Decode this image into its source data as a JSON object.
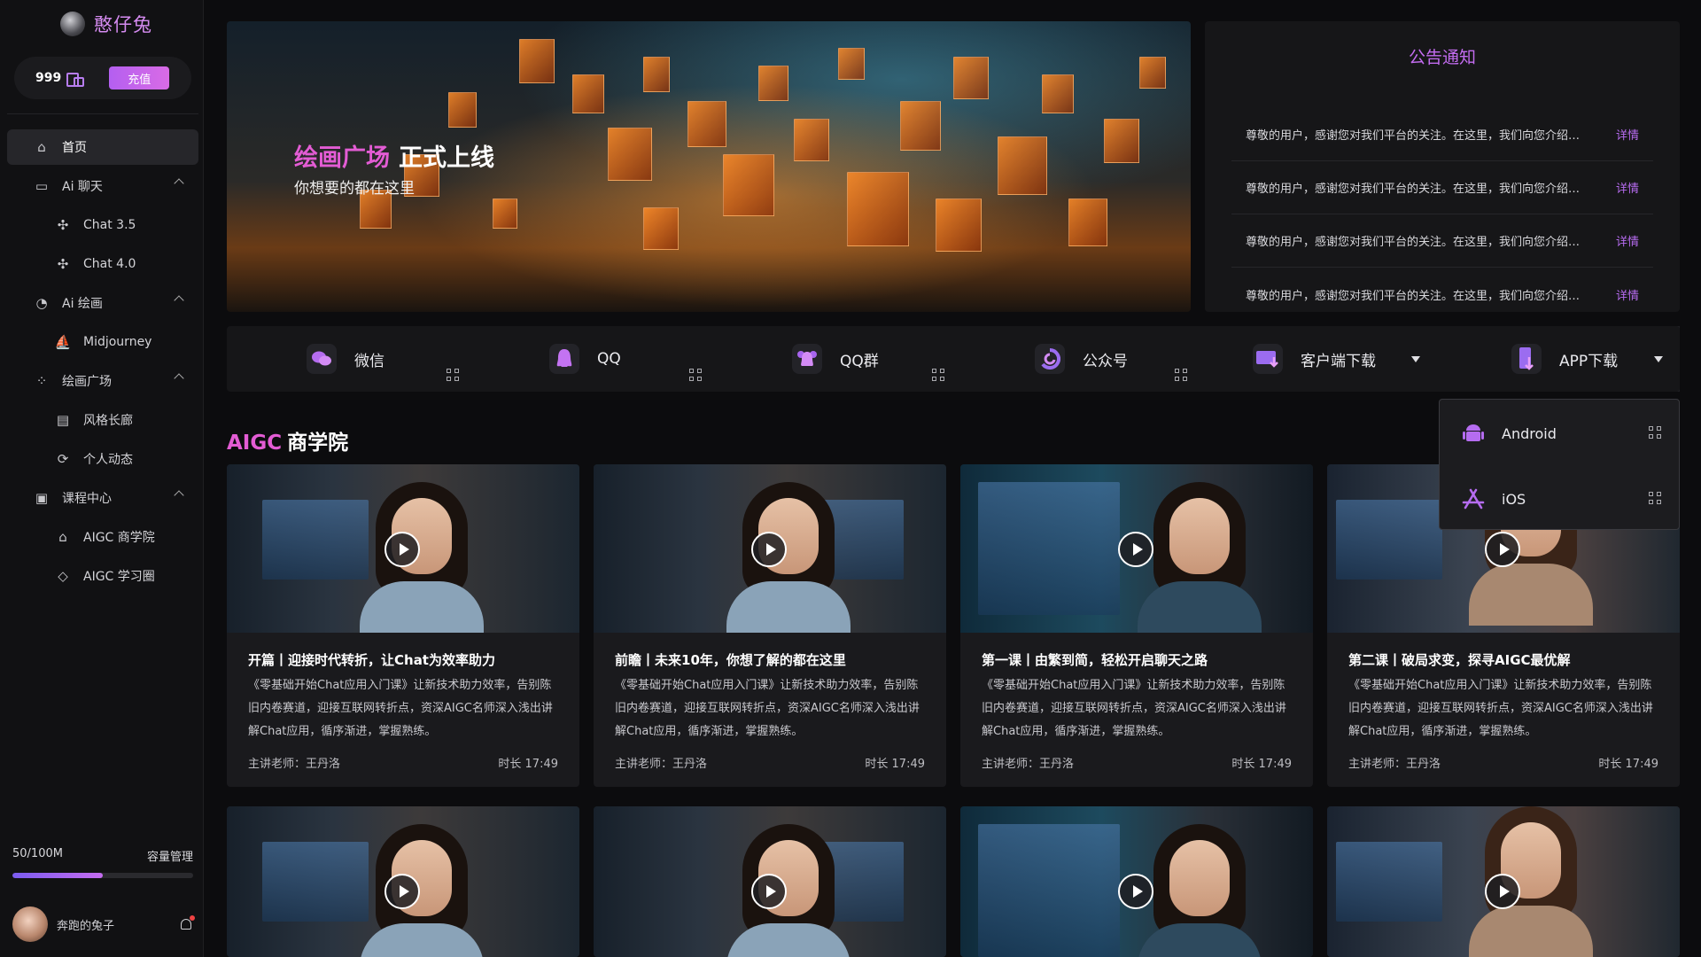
{
  "brand": {
    "name": "憨仔兔"
  },
  "balance": {
    "amount": "999",
    "recharge_label": "充值"
  },
  "nav": {
    "home": "首页",
    "ai_chat": "Ai 聊天",
    "chat35": "Chat 3.5",
    "chat40": "Chat 4.0",
    "ai_paint": "Ai 绘画",
    "midjourney": "Midjourney",
    "plaza": "绘画广场",
    "gallery": "风格长廊",
    "feed": "个人动态",
    "courses": "课程中心",
    "aigc_school": "AIGC 商学院",
    "aigc_circle": "AIGC 学习圈"
  },
  "storage": {
    "usage": "50/100M",
    "manage_label": "容量管理",
    "fraction": 0.5
  },
  "user": {
    "name": "奔跑的兔子"
  },
  "banner": {
    "title_highlight": "绘画广场",
    "title_rest": "正式上线",
    "subtitle": "你想要的都在这里"
  },
  "notice": {
    "title": "公告通知",
    "items": [
      {
        "text": "尊敬的用户，感谢您对我们平台的关注。在这里，我们向您介绍平台的最新动态与功能更新。",
        "link": "详情"
      },
      {
        "text": "尊敬的用户，感谢您对我们平台的关注。在这里，我们向您介绍平台的最新动态与功能更新。",
        "link": "详情"
      },
      {
        "text": "尊敬的用户，感谢您对我们平台的关注。在这里，我们向您介绍平台的最新动态与功能更新。",
        "link": "详情"
      },
      {
        "text": "尊敬的用户，感谢您对我们平台的关注。在这里，我们向您介绍平台的最新动态与功能更新。",
        "link": "详情"
      }
    ]
  },
  "social": {
    "wechat": "微信",
    "qq": "QQ",
    "qq_group": "QQ群",
    "official": "公众号",
    "client_download": "客户端下载",
    "app_download": "APP下载"
  },
  "dropdown": {
    "android": "Android",
    "ios": "iOS"
  },
  "section": {
    "title_highlight": "AIGC",
    "title_rest": "商学院"
  },
  "courses": [
    {
      "title": "开篇丨迎接时代转折，让Chat为效率助力",
      "desc": "《零基础开始Chat应用入门课》让新技术助力效率，告别陈旧内卷赛道，迎接互联网转折点，资深AIGC名师深入浅出讲解Chat应用，循序渐进，掌握熟练。",
      "teacher": "主讲老师：王丹洛",
      "duration": "时长 17:49"
    },
    {
      "title": "前瞻丨未来10年，你想了解的都在这里",
      "desc": "《零基础开始Chat应用入门课》让新技术助力效率，告别陈旧内卷赛道，迎接互联网转折点，资深AIGC名师深入浅出讲解Chat应用，循序渐进，掌握熟练。",
      "teacher": "主讲老师：王丹洛",
      "duration": "时长 17:49"
    },
    {
      "title": "第一课丨由繁到简，轻松开启聊天之路",
      "desc": "《零基础开始Chat应用入门课》让新技术助力效率，告别陈旧内卷赛道，迎接互联网转折点，资深AIGC名师深入浅出讲解Chat应用，循序渐进，掌握熟练。",
      "teacher": "主讲老师：王丹洛",
      "duration": "时长 17:49"
    },
    {
      "title": "第二课丨破局求变，探寻AIGC最优解",
      "desc": "《零基础开始Chat应用入门课》让新技术助力效率，告别陈旧内卷赛道，迎接互联网转折点，资深AIGC名师深入浅出讲解Chat应用，循序渐进，掌握熟练。",
      "teacher": "主讲老师：王丹洛",
      "duration": "时长 17:49"
    }
  ],
  "colors": {
    "accent": "#c36cf0",
    "highlight": "#e35cd4",
    "background": "#0c0c0e"
  }
}
